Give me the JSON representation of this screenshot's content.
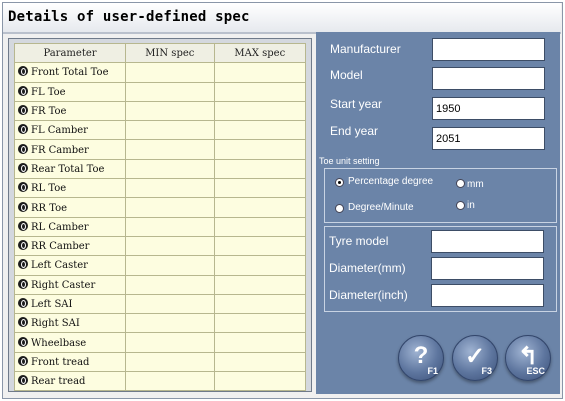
{
  "window": {
    "title": "Details of user-defined spec"
  },
  "table": {
    "headers": [
      "Parameter",
      "MIN spec",
      "MAX spec"
    ],
    "rows": [
      {
        "param": "Front Total Toe",
        "min": "",
        "max": ""
      },
      {
        "param": "FL Toe",
        "min": "",
        "max": ""
      },
      {
        "param": "FR Toe",
        "min": "",
        "max": ""
      },
      {
        "param": "FL Camber",
        "min": "",
        "max": ""
      },
      {
        "param": "FR Camber",
        "min": "",
        "max": ""
      },
      {
        "param": "Rear Total Toe",
        "min": "",
        "max": ""
      },
      {
        "param": "RL Toe",
        "min": "",
        "max": ""
      },
      {
        "param": "RR Toe",
        "min": "",
        "max": ""
      },
      {
        "param": "RL Camber",
        "min": "",
        "max": ""
      },
      {
        "param": "RR Camber",
        "min": "",
        "max": ""
      },
      {
        "param": "Left Caster",
        "min": "",
        "max": ""
      },
      {
        "param": "Right Caster",
        "min": "",
        "max": ""
      },
      {
        "param": "Left SAI",
        "min": "",
        "max": ""
      },
      {
        "param": "Right SAI",
        "min": "",
        "max": ""
      },
      {
        "param": "Wheelbase",
        "min": "",
        "max": ""
      },
      {
        "param": "Front tread",
        "min": "",
        "max": ""
      },
      {
        "param": "Rear tread",
        "min": "",
        "max": ""
      }
    ]
  },
  "vehicle": {
    "manufacturer_label": "Manufacturer",
    "manufacturer_value": "",
    "model_label": "Model",
    "model_value": "",
    "start_year_label": "Start year",
    "start_year_value": "1950",
    "end_year_label": "End year",
    "end_year_value": "2051"
  },
  "toe_unit": {
    "label": "Toe unit setting",
    "options": [
      {
        "label": "Percentage degree",
        "selected": true
      },
      {
        "label": "mm",
        "selected": false
      },
      {
        "label": "Degree/Minute",
        "selected": false
      },
      {
        "label": "in",
        "selected": false
      }
    ]
  },
  "tyre": {
    "model_label": "Tyre model",
    "model_value": "",
    "diameter_mm_label": "Diameter(mm)",
    "diameter_mm_value": "",
    "diameter_inch_label": "Diameter(inch)",
    "diameter_inch_value": ""
  },
  "buttons": [
    {
      "name": "help",
      "icon": "question-icon",
      "key": "F1"
    },
    {
      "name": "confirm",
      "icon": "checkmark-icon",
      "key": "F3"
    },
    {
      "name": "exit",
      "icon": "back-arrow-icon",
      "key": "ESC"
    }
  ],
  "colors": {
    "panel": "#6b84a8",
    "cell": "#fdfde0"
  }
}
